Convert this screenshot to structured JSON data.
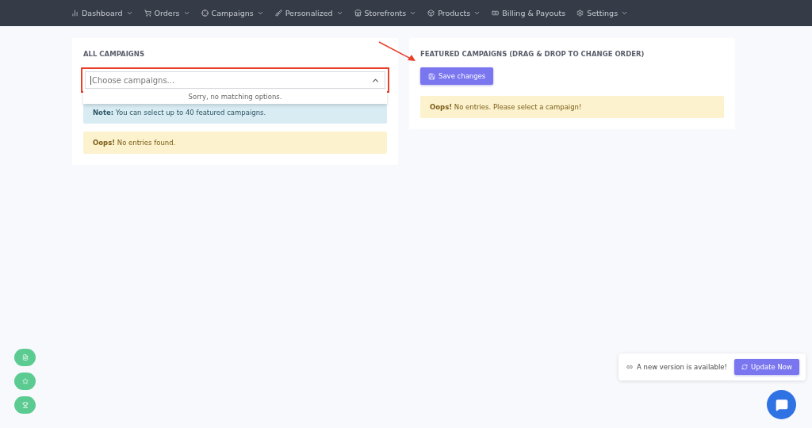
{
  "nav": [
    {
      "kind": "chart",
      "label": "Dashboard",
      "dropdown": true
    },
    {
      "kind": "cart",
      "label": "Orders",
      "dropdown": true
    },
    {
      "kind": "target",
      "label": "Campaigns",
      "dropdown": true
    },
    {
      "kind": "brush",
      "label": "Personalized",
      "dropdown": true
    },
    {
      "kind": "store",
      "label": "Storefronts",
      "dropdown": true
    },
    {
      "kind": "box",
      "label": "Products",
      "dropdown": true
    },
    {
      "kind": "money",
      "label": "Billing & Payouts",
      "dropdown": false
    },
    {
      "kind": "gear",
      "label": "Settings",
      "dropdown": true
    }
  ],
  "all_campaigns": {
    "title": "ALL CAMPAIGNS",
    "select": {
      "placeholder": "Choose campaigns...",
      "expanded": true,
      "highlighted": true,
      "menu_message": "Sorry, no matching options."
    },
    "note": "**Note:** You can select up to 40 featured campaigns.",
    "alert": "**Oops!** No entries found."
  },
  "featured": {
    "title": "FEATURED CAMPAIGNS (DRAG & DROP TO CHANGE ORDER)",
    "button": "Save changes",
    "alert": "**Oops!** No entries. Please select a campaign!"
  },
  "floating_buttons": [
    {
      "kind": "page"
    },
    {
      "kind": "star"
    },
    {
      "kind": "trophy"
    }
  ],
  "update_toast": {
    "message": "A new version is available!",
    "button": "Update Now"
  }
}
